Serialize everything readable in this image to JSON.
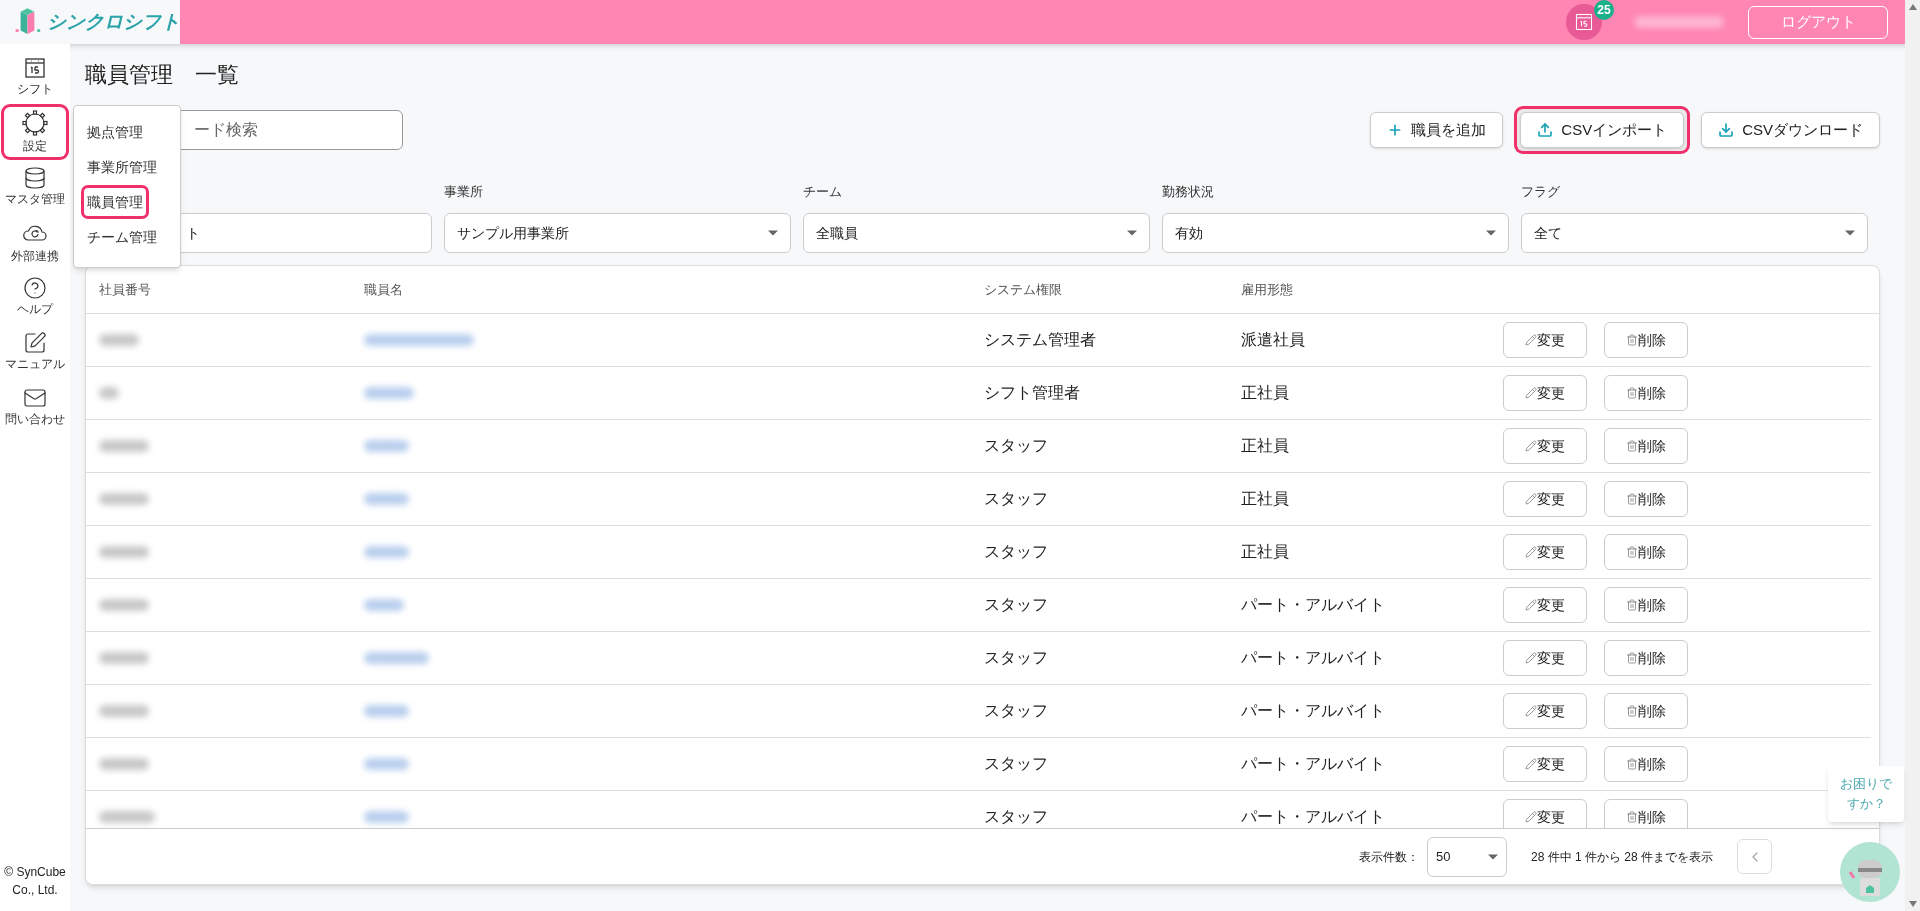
{
  "header": {
    "app_name": "シンクロシフト",
    "notification_count": "25",
    "logout": "ログアウト"
  },
  "sidebar": {
    "items": [
      {
        "kind": "calendar",
        "label": "シフト",
        "selected": false
      },
      {
        "kind": "settings",
        "label": "設定",
        "selected": true
      },
      {
        "kind": "database",
        "label": "マスタ管理",
        "selected": false
      },
      {
        "kind": "cloud",
        "label": "外部連携",
        "selected": false
      },
      {
        "kind": "help",
        "label": "ヘルプ",
        "selected": false
      },
      {
        "kind": "manual",
        "label": "マニュアル",
        "selected": false
      },
      {
        "kind": "mail",
        "label": "問い合わせ",
        "selected": false
      }
    ],
    "copyright": "© SynCube Co., Ltd."
  },
  "settings_menu": {
    "items": [
      {
        "label": "拠点管理",
        "selected": false
      },
      {
        "label": "事業所管理",
        "selected": false
      },
      {
        "label": "職員管理",
        "selected": true
      },
      {
        "label": "チーム管理",
        "selected": false
      }
    ]
  },
  "page_title": "職員管理　一覧",
  "search": {
    "placeholder": "ード検索"
  },
  "actions": [
    {
      "kind": "add",
      "label": "職員を追加",
      "highlighted": false
    },
    {
      "kind": "import",
      "label": "CSVインポート",
      "highlighted": true
    },
    {
      "kind": "download",
      "label": "CSVダウンロード",
      "highlighted": false
    }
  ],
  "filters": [
    {
      "value": "ト"
    },
    {
      "label": "事業所",
      "value": "サンプル用事業所"
    },
    {
      "label": "チーム",
      "value": "全職員"
    },
    {
      "label": "勤務状況",
      "value": "有効"
    },
    {
      "label": "フラグ",
      "value": "全て"
    }
  ],
  "table": {
    "columns": [
      "社員番号",
      "職員名",
      "システム権限",
      "雇用形態"
    ],
    "rows": [
      {
        "role": "システム管理者",
        "employment": "派遣社員",
        "edit": "変更",
        "delete": "削除"
      },
      {
        "role": "シフト管理者",
        "employment": "正社員",
        "edit": "変更",
        "delete": "削除"
      },
      {
        "role": "スタッフ",
        "employment": "正社員",
        "edit": "変更",
        "delete": "削除"
      },
      {
        "role": "スタッフ",
        "employment": "正社員",
        "edit": "変更",
        "delete": "削除"
      },
      {
        "role": "スタッフ",
        "employment": "正社員",
        "edit": "変更",
        "delete": "削除"
      },
      {
        "role": "スタッフ",
        "employment": "パート・アルバイト",
        "edit": "変更",
        "delete": "削除"
      },
      {
        "role": "スタッフ",
        "employment": "パート・アルバイト",
        "edit": "変更",
        "delete": "削除"
      },
      {
        "role": "スタッフ",
        "employment": "パート・アルバイト",
        "edit": "変更",
        "delete": "削除"
      },
      {
        "role": "スタッフ",
        "employment": "パート・アルバイト",
        "edit": "変更",
        "delete": "削除"
      },
      {
        "role": "スタッフ",
        "employment": "パート・アルバイト",
        "edit": "変更",
        "delete": "削除"
      }
    ]
  },
  "pagination": {
    "per_page_label": "表示件数：",
    "per_page": "50",
    "summary": "28 件中 1 件から 28 件までを表示"
  },
  "help_bubble": "お困りですか？"
}
